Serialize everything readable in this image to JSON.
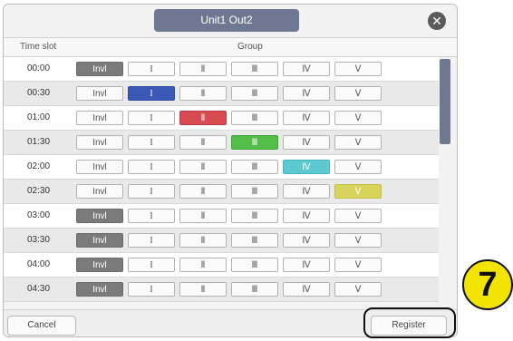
{
  "dialog": {
    "title": "Unit1 Out2",
    "close_label": "✕",
    "header": {
      "time_slot": "Time slot",
      "group": "Group"
    }
  },
  "groups": [
    "Invl",
    "I",
    "Ⅱ",
    "Ⅲ",
    "Ⅳ",
    "Ⅴ"
  ],
  "rows": [
    {
      "time": "00:00",
      "selected": "Invl"
    },
    {
      "time": "00:30",
      "selected": "I"
    },
    {
      "time": "01:00",
      "selected": "II"
    },
    {
      "time": "01:30",
      "selected": "III"
    },
    {
      "time": "02:00",
      "selected": "IV"
    },
    {
      "time": "02:30",
      "selected": "V"
    },
    {
      "time": "03:00",
      "selected": "Invl"
    },
    {
      "time": "03:30",
      "selected": "Invl"
    },
    {
      "time": "04:00",
      "selected": "Invl"
    },
    {
      "time": "04:30",
      "selected": "Invl"
    }
  ],
  "footer": {
    "cancel_label": "Cancel",
    "register_label": "Register"
  },
  "callout": {
    "step": "7"
  },
  "colors": {
    "Invl": "#7b7b7b",
    "I": "#3c58b7",
    "II": "#d84b53",
    "III": "#52bd48",
    "IV": "#5ccad0",
    "V": "#d8d35a",
    "title_bg": "#6f7892",
    "callout": "#f2e400"
  }
}
